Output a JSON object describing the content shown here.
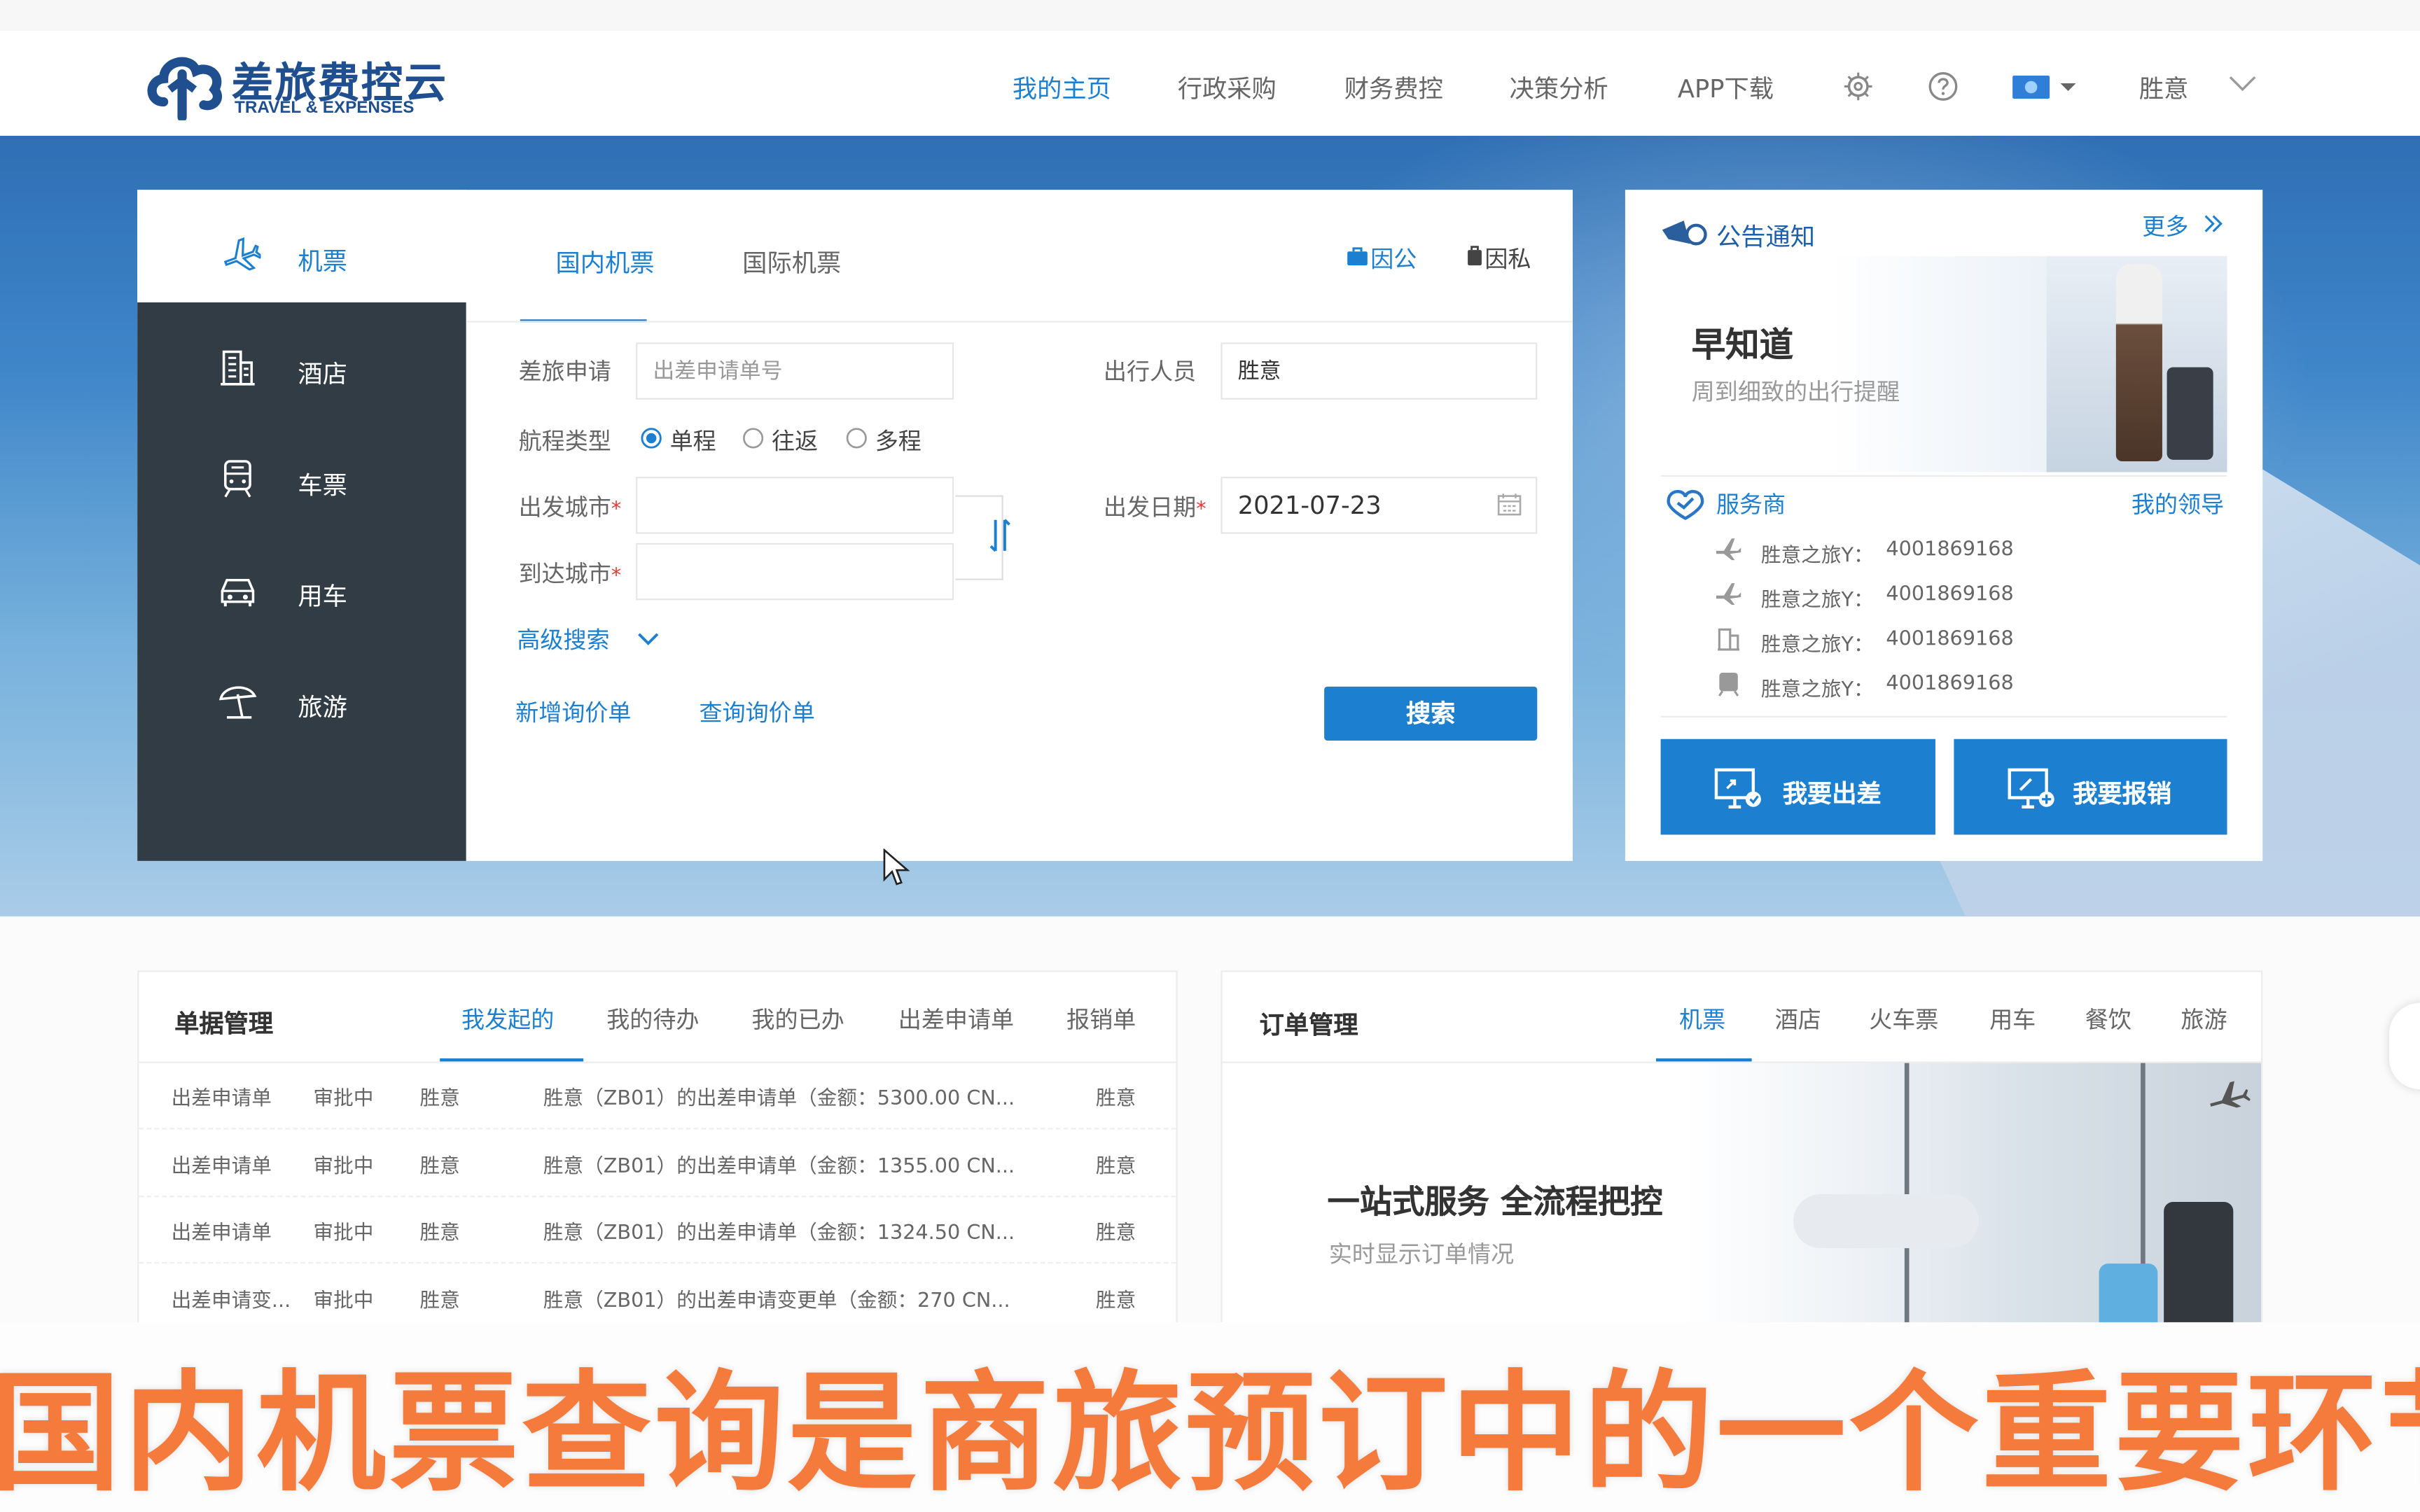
{
  "brand": {
    "name": "差旅费控云",
    "sub": "TRAVEL & EXPENSES"
  },
  "nav": {
    "items": [
      {
        "label": "我的主页"
      },
      {
        "label": "行政采购"
      },
      {
        "label": "财务费控"
      },
      {
        "label": "决策分析"
      },
      {
        "label": "APP下载"
      }
    ],
    "user": "胜意"
  },
  "booking": {
    "sidebar": [
      {
        "label": "机票",
        "icon": "plane-icon"
      },
      {
        "label": "酒店",
        "icon": "hotel-icon"
      },
      {
        "label": "车票",
        "icon": "train-icon"
      },
      {
        "label": "用车",
        "icon": "car-icon"
      },
      {
        "label": "旅游",
        "icon": "umbrella-icon"
      }
    ],
    "tabs": [
      {
        "label": "国内机票"
      },
      {
        "label": "国际机票"
      }
    ],
    "purpose": {
      "business": "因公",
      "private": "因私"
    },
    "form": {
      "trip_request_label": "差旅申请",
      "trip_request_placeholder": "出差申请单号",
      "traveler_label": "出行人员",
      "traveler_value": "胜意",
      "route_label": "航程类型",
      "route_options": [
        "单程",
        "往返",
        "多程"
      ],
      "from_label": "出发城市",
      "to_label": "到达城市",
      "date_label": "出发日期",
      "date_value": "2021-07-23",
      "advanced": "高级搜索"
    },
    "links": {
      "new_inquiry": "新增询价单",
      "query_inquiry": "查询询价单"
    },
    "search_button": "搜索"
  },
  "notice": {
    "title": "公告通知",
    "more": "更多",
    "promo_title": "早知道",
    "promo_sub": "周到细致的出行提醒",
    "provider_title": "服务商",
    "my_leader": "我的领导",
    "providers": [
      {
        "name": "胜意之旅Y：",
        "phone": "4001869168",
        "icon": "plane-icon"
      },
      {
        "name": "胜意之旅Y：",
        "phone": "4001869168",
        "icon": "plane-icon"
      },
      {
        "name": "胜意之旅Y：",
        "phone": "4001869168",
        "icon": "hotel-icon"
      },
      {
        "name": "胜意之旅Y：",
        "phone": "4001869168",
        "icon": "train-icon"
      }
    ],
    "btn_travel": "我要出差",
    "btn_reimburse": "我要报销"
  },
  "documents": {
    "title": "单据管理",
    "tabs": [
      {
        "label": "我发起的"
      },
      {
        "label": "我的待办"
      },
      {
        "label": "我的已办"
      },
      {
        "label": "出差申请单"
      },
      {
        "label": "报销单"
      }
    ],
    "rows": [
      {
        "type": "出差申请单",
        "status": "审批中",
        "person": "胜意",
        "desc": "胜意（ZB01）的出差申请单（金额：5300.00 CN...",
        "owner": "胜意"
      },
      {
        "type": "出差申请单",
        "status": "审批中",
        "person": "胜意",
        "desc": "胜意（ZB01）的出差申请单（金额：1355.00 CN...",
        "owner": "胜意"
      },
      {
        "type": "出差申请单",
        "status": "审批中",
        "person": "胜意",
        "desc": "胜意（ZB01）的出差申请单（金额：1324.50 CN...",
        "owner": "胜意"
      },
      {
        "type": "出差申请变...",
        "status": "审批中",
        "person": "胜意",
        "desc": "胜意（ZB01）的出差申请变更单（金额：270 CN...",
        "owner": "胜意"
      }
    ]
  },
  "orders": {
    "title": "订单管理",
    "tabs": [
      {
        "label": "机票"
      },
      {
        "label": "酒店"
      },
      {
        "label": "火车票"
      },
      {
        "label": "用车"
      },
      {
        "label": "餐饮"
      },
      {
        "label": "旅游"
      }
    ],
    "promo_title": "一站式服务 全流程把控",
    "promo_sub": "实时显示订单情况"
  },
  "caption": "国内机票查询是商旅预订中的一个重要环节",
  "colors": {
    "accent": "#1d7fcf",
    "sidebar": "#323c44",
    "caption": "#f47b3c"
  }
}
